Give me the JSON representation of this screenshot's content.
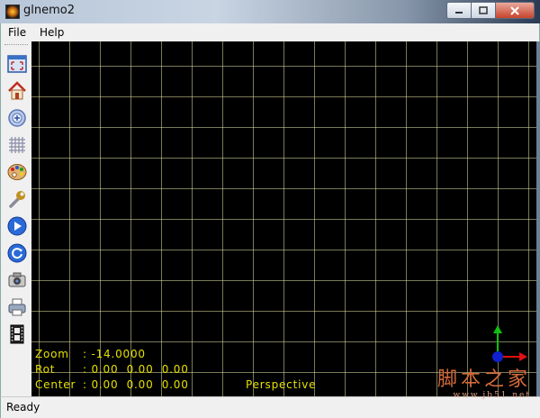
{
  "window": {
    "title": "glnemo2"
  },
  "menu": {
    "items": [
      "File",
      "Help"
    ]
  },
  "toolbar": {
    "buttons": [
      {
        "icon": "fullscreen-icon"
      },
      {
        "icon": "home-icon"
      },
      {
        "icon": "zoom-icon"
      },
      {
        "icon": "grid-icon"
      },
      {
        "icon": "palette-icon"
      },
      {
        "icon": "wrench-icon"
      },
      {
        "icon": "play-icon"
      },
      {
        "icon": "reload-icon"
      },
      {
        "icon": "camera-icon"
      },
      {
        "icon": "print-icon"
      },
      {
        "icon": "film-icon"
      }
    ]
  },
  "viewport": {
    "zoom_label": "Zoom",
    "zoom_value": ": -14.0000",
    "rot_label": "Rot",
    "rot_value": ": 0.00  0.00  0.00",
    "center_label": "Center",
    "center_value": ": 0.00  0.00  0.00",
    "projection": "Perspective",
    "grid_color": "#dcdca0",
    "text_color": "#e5e000"
  },
  "status": {
    "text": "Ready"
  },
  "watermark": {
    "main": "脚本之家",
    "url": "www.jb51.net"
  }
}
